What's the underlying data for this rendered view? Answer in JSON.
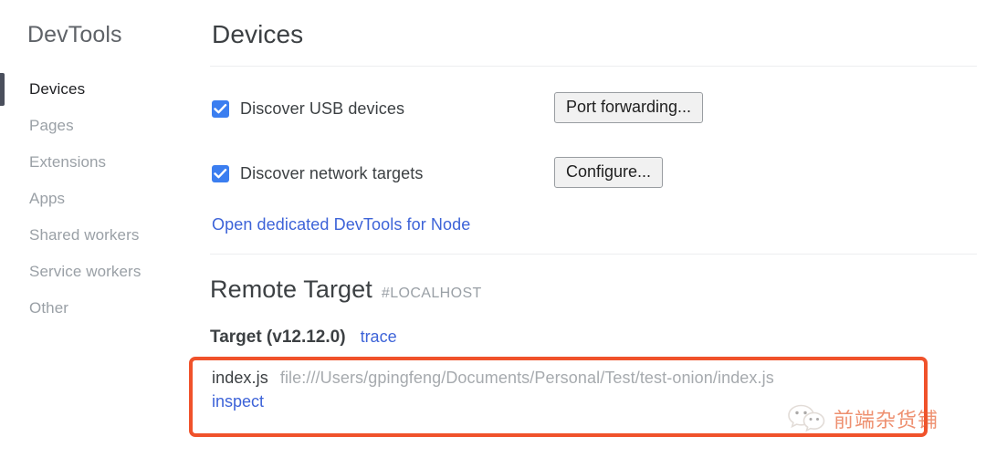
{
  "sidebar": {
    "title": "DevTools",
    "items": [
      {
        "label": "Devices",
        "active": true
      },
      {
        "label": "Pages",
        "active": false
      },
      {
        "label": "Extensions",
        "active": false
      },
      {
        "label": "Apps",
        "active": false
      },
      {
        "label": "Shared workers",
        "active": false
      },
      {
        "label": "Service workers",
        "active": false
      },
      {
        "label": "Other",
        "active": false
      }
    ]
  },
  "main": {
    "page_title": "Devices",
    "discover_usb": {
      "label": "Discover USB devices",
      "checked": true,
      "button_label": "Port forwarding..."
    },
    "discover_network": {
      "label": "Discover network targets",
      "checked": true,
      "button_label": "Configure..."
    },
    "node_link_label": "Open dedicated DevTools for Node",
    "remote_target": {
      "title": "Remote Target",
      "hash": "#LOCALHOST",
      "target_name": "Target (v12.12.0)",
      "trace_label": "trace",
      "entry": {
        "file": "index.js",
        "path": "file:///Users/gpingfeng/Documents/Personal/Test/test-onion/index.js",
        "inspect_label": "inspect"
      }
    }
  },
  "watermark": {
    "text": "前端杂货铺",
    "icon": "wechat-icon"
  },
  "colors": {
    "accent_link": "#3d63d8",
    "checkbox_blue": "#3b7ef0",
    "highlight_orange": "#f0522b",
    "active_marker": "#4a4f5c",
    "watermark_orange": "#e8663a"
  }
}
